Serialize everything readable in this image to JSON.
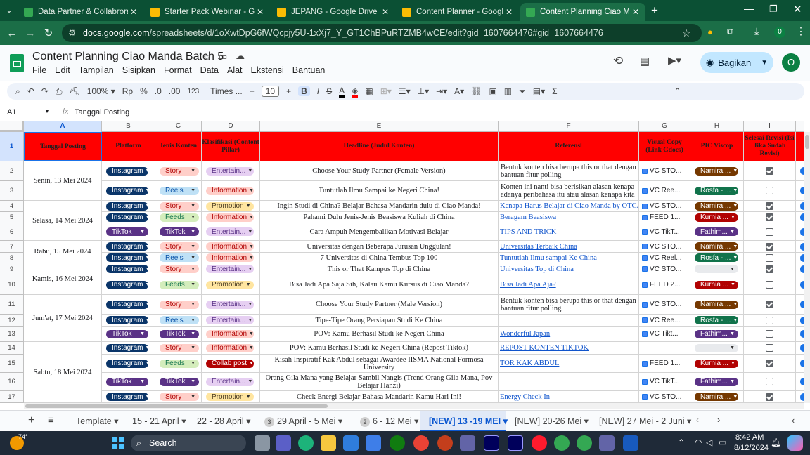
{
  "browser": {
    "tabs": [
      {
        "title": "Data Partner & Collabroration",
        "favicon": "sheets",
        "color": "#34a853"
      },
      {
        "title": "Starter Pack Webinar - Google",
        "favicon": "drive",
        "color": "#fbbc04"
      },
      {
        "title": "JEPANG - Google Drive",
        "favicon": "drive",
        "color": "#fbbc04"
      },
      {
        "title": "Content Planner - Google Drive",
        "favicon": "drive",
        "color": "#fbbc04"
      },
      {
        "title": "Content Planning Ciao Manda",
        "favicon": "sheets",
        "color": "#34a853",
        "active": true
      }
    ],
    "new_tab": "+",
    "url_host": "docs.google.com",
    "url_path": "/spreadsheets/d/1oXwtDpG6fWQcpjy5U-1xXj7_Y_GT1ChBPuRTZMB4wCE/edit?gid=1607664476#gid=1607664476",
    "profile_badge": "0"
  },
  "doc": {
    "title": "Content Planning Ciao Manda Batch 5",
    "menu": [
      "File",
      "Edit",
      "Tampilan",
      "Sisipkan",
      "Format",
      "Data",
      "Alat",
      "Ekstensi",
      "Bantuan"
    ],
    "share_label": "Bagikan",
    "avatar_letter": "O"
  },
  "toolbar": {
    "zoom": "100%",
    "currency": "Rp",
    "percent": "%",
    "dec_less": ".0",
    "dec_more": ".00",
    "number_format": "123",
    "font": "Times ...",
    "font_size": "10",
    "bold": "B",
    "italic": "I"
  },
  "formula_bar": {
    "cell_ref": "A1",
    "fx": "fx",
    "content": "Tanggal Posting"
  },
  "columns": [
    "A",
    "B",
    "C",
    "D",
    "E",
    "F",
    "G",
    "H",
    "I"
  ],
  "header_row": {
    "row": "1",
    "cells": [
      "Tanggal Posting",
      "Platform",
      "Jenis Konten",
      "Klasifikasi (Content Pillar)",
      "Headline (Judul Konten)",
      "Referensi",
      "Visual Copy (Link Gdocs)",
      "PIC Viscop",
      "Selesai Revisi (Isi Jika Sudah Revisi)"
    ]
  },
  "dates": [
    {
      "label": "Senin, 13 Mei 2024"
    },
    {
      "label": "Selasa, 14 Mei 2024"
    },
    {
      "label": "Rabu, 15 Mei 2024"
    },
    {
      "label": "Kamis, 16 Mei 2024"
    },
    {
      "label": "Jum'at, 17 Mei 2024"
    },
    {
      "label": "Sabtu, 18 Mei 2024"
    }
  ],
  "rows": [
    {
      "n": "2",
      "platform": "Instagram",
      "jenis": "Story",
      "klas": "Entertain...",
      "headline": "Choose Your Study Partner (Female Version)",
      "ref": "Bentuk konten bisa berupa this or that dengan bantuan fitur polling",
      "ref_link": false,
      "visual": "VC STO...",
      "pic": "Namira ...",
      "done": true
    },
    {
      "n": "3",
      "platform": "Instagram",
      "jenis": "Reels",
      "klas": "Information",
      "headline": "Tuntutlah Ilmu Sampai ke Negeri China!",
      "ref": "Konten ini nanti bisa berisikan alasan kenapa adanya peribahasa itu atau alasan kenapa kita",
      "ref_link": false,
      "visual": "VC Ree...",
      "pic": "Rosfa - ...",
      "done": false
    },
    {
      "n": "4",
      "platform": "Instagram",
      "jenis": "Story",
      "klas": "Promotion",
      "headline": "Ingin Studi di China? Belajar Bahasa Mandarin dulu di Ciao Manda!",
      "ref": "Kenapa Harus Belajar di Ciao Manda by OTCA?",
      "ref_link": true,
      "visual": "VC STO...",
      "pic": "Namira ...",
      "done": true
    },
    {
      "n": "5",
      "platform": "Instagram",
      "jenis": "Feeds",
      "klas": "Information",
      "headline": "Pahami Dulu Jenis-Jenis Beasiswa Kuliah di China",
      "ref": "Beragam Beasiswa",
      "ref_link": true,
      "visual": "FEED 1...",
      "pic": "Kurnia ...",
      "done": true
    },
    {
      "n": "6",
      "platform": "TikTok",
      "jenis": "TikTok",
      "klas": "Entertain...",
      "headline": "Cara Ampuh Mengembalikan Motivasi Belajar",
      "ref": "TIPS AND TRICK",
      "ref_link": true,
      "visual": "VC TikT...",
      "pic": "Fathim...",
      "done": false
    },
    {
      "n": "7",
      "platform": "Instagram",
      "jenis": "Story",
      "klas": "Information",
      "headline": "Universitas dengan Beberapa Jurusan Unggulan!",
      "ref": "Universitas Terbaik China",
      "ref_link": true,
      "visual": "VC STO...",
      "pic": "Namira ...",
      "done": true
    },
    {
      "n": "8",
      "platform": "Instagram",
      "jenis": "Reels",
      "klas": "Information",
      "headline": "7 Universitas di China Tembus Top 100",
      "ref": "Tuntutlah Ilmu sampai Ke China",
      "ref_link": true,
      "visual": "VC Reel...",
      "pic": "Rosfa - ...",
      "done": false
    },
    {
      "n": "9",
      "platform": "Instagram",
      "jenis": "Story",
      "klas": "Entertain...",
      "headline": "This or That Kampus Top di China",
      "ref": "Universitas Top di China",
      "ref_link": true,
      "visual": "VC STO...",
      "pic": "",
      "done": true
    },
    {
      "n": "10",
      "platform": "Instagram",
      "jenis": "Feeds",
      "klas": "Promotion",
      "headline": "Bisa Jadi Apa Saja Sih, Kalau Kamu Kursus di Ciao Manda?",
      "ref": "Bisa Jadi Apa Aja?",
      "ref_link": true,
      "visual": "FEED 2...",
      "pic": "Kurnia ...",
      "done": false
    },
    {
      "n": "11",
      "platform": "Instagram",
      "jenis": "Story",
      "klas": "Entertain...",
      "headline": "Choose Your Study Partner (Male Version)",
      "ref": "Bentuk konten bisa berupa this or that dengan bantuan fitur polling",
      "ref_link": false,
      "visual": "VC STO...",
      "pic": "Namira ...",
      "done": true
    },
    {
      "n": "12",
      "platform": "Instagram",
      "jenis": "Reels",
      "klas": "Entertain...",
      "headline": "Tipe-Tipe Orang Persiapan Studi Ke China",
      "ref": "",
      "ref_link": false,
      "visual": "VC Ree...",
      "pic": "Rosfa - ...",
      "done": false
    },
    {
      "n": "13",
      "platform": "TikTok",
      "jenis": "TikTok",
      "klas": "Information",
      "headline": "POV: Kamu Berhasil Studi ke Negeri China",
      "ref": "Wonderful Japan",
      "ref_link": true,
      "visual": "VC Tikt...",
      "pic": "Fathim...",
      "done": false
    },
    {
      "n": "14",
      "platform": "Instagram",
      "jenis": "Story",
      "klas": "Information",
      "headline": "POV: Kamu Berhasil Studi ke Negeri China (Repost Tiktok)",
      "ref": "REPOST KONTEN TIKTOK",
      "ref_link": true,
      "visual": "",
      "pic": "",
      "done": false
    },
    {
      "n": "15",
      "platform": "Instagram",
      "jenis": "Feeds",
      "klas": "Collab post",
      "headline": "Kisah Inspiratif Kak Abdul sebagai Awardee IISMA National Formosa University",
      "ref": "TOR KAK ABDUL",
      "ref_link": true,
      "visual": "FEED 1...",
      "pic": "Kurnia ...",
      "done": true
    },
    {
      "n": "16",
      "platform": "TikTok",
      "jenis": "TikTok",
      "klas": "Entertain...",
      "headline": "Orang Gila Mana yang Belajar Sambil Nangis (Trend Orang Gila Mana, Pov Belajar Hanzi)",
      "ref": "",
      "ref_link": false,
      "visual": "VC TikT...",
      "pic": "Fathim...",
      "done": false
    },
    {
      "n": "17",
      "platform": "Instagram",
      "jenis": "Story",
      "klas": "Promotion",
      "headline": "Check Energi Belajar Bahasa Mandarin Kamu Hari Ini!",
      "ref": "Energy Check In",
      "ref_link": true,
      "visual": "VC STO...",
      "pic": "Namira ...",
      "done": true
    }
  ],
  "chip_colors": {
    "Instagram": {
      "bg": "#0a3569",
      "fg": "#ffffff"
    },
    "TikTok": {
      "bg": "#5a3286",
      "fg": "#ffffff"
    },
    "Story": {
      "bg": "#ffcfc9",
      "fg": "#b10202"
    },
    "Reels": {
      "bg": "#bfe1f6",
      "fg": "#0a53a8"
    },
    "Feeds": {
      "bg": "#d4edbc",
      "fg": "#11734b"
    },
    "Entertain...": {
      "bg": "#e6cff2",
      "fg": "#5a3286"
    },
    "Information": {
      "bg": "#ffcfc9",
      "fg": "#b10202"
    },
    "Promotion": {
      "bg": "#ffe5a0",
      "fg": "#473821"
    },
    "Collab post": {
      "bg": "#b10202",
      "fg": "#ffffff"
    },
    "Namira ...": {
      "bg": "#753800",
      "fg": "#ffffff"
    },
    "Rosfa - ...": {
      "bg": "#11734b",
      "fg": "#ffffff"
    },
    "Kurnia ...": {
      "bg": "#b10202",
      "fg": "#ffffff"
    },
    "Fathim...": {
      "bg": "#5a3286",
      "fg": "#ffffff"
    },
    "": {
      "bg": "#e8eaed",
      "fg": "#444444"
    }
  },
  "sheet_tabs": [
    {
      "label": "Template"
    },
    {
      "label": "15 - 21 April"
    },
    {
      "label": "22 - 28 April"
    },
    {
      "label": "29 April - 5 Mei",
      "badge": "3"
    },
    {
      "label": "6 - 12 Mei",
      "badge": "2"
    },
    {
      "label": "[NEW] 13 -19 MEI",
      "active": true
    },
    {
      "label": "[NEW] 20-26 Mei"
    },
    {
      "label": "[NEW] 27 Mei - 2 Juni"
    }
  ],
  "taskbar": {
    "weather": "74°",
    "search": "Search",
    "time": "8:42 AM",
    "date": "8/12/2024"
  }
}
